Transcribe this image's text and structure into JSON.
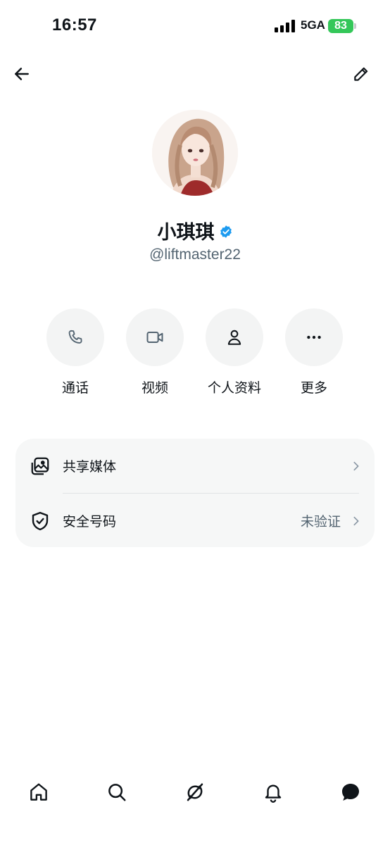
{
  "status_bar": {
    "time": "16:57",
    "network": "5GA",
    "battery": "83"
  },
  "header": {
    "back_icon": "arrow-left-icon",
    "edit_icon": "pencil-icon"
  },
  "profile": {
    "name": "小琪琪",
    "handle": "@liftmaster22",
    "verified_color": "#1d9bf0"
  },
  "actions": [
    {
      "icon": "phone-icon",
      "label": "通话"
    },
    {
      "icon": "video-icon",
      "label": "视频"
    },
    {
      "icon": "person-icon",
      "label": "个人资料"
    },
    {
      "icon": "more-icon",
      "label": "更多"
    }
  ],
  "settings": {
    "shared_media": {
      "label": "共享媒体"
    },
    "security_code": {
      "label": "安全号码",
      "value": "未验证"
    }
  },
  "bottom_nav": [
    {
      "icon": "home-icon"
    },
    {
      "icon": "search-icon"
    },
    {
      "icon": "grok-icon"
    },
    {
      "icon": "bell-icon"
    },
    {
      "icon": "messages-icon"
    }
  ],
  "colors": {
    "battery": "#34c759",
    "text_primary": "#0f1419",
    "text_secondary": "#536471",
    "card_bg": "#f6f7f7"
  }
}
